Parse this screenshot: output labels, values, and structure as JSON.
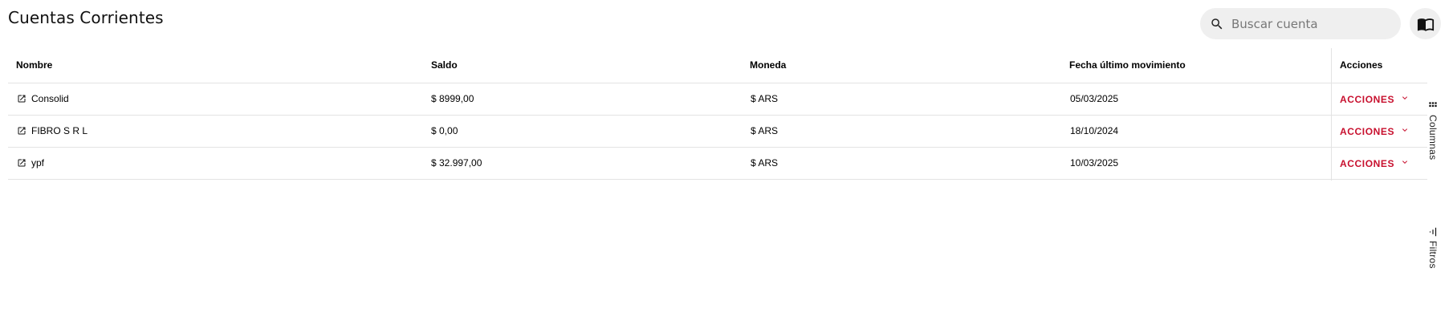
{
  "page": {
    "title": "Cuentas Corrientes"
  },
  "search": {
    "placeholder": "Buscar cuenta",
    "value": ""
  },
  "toolbar": {
    "doc_icon": "menu-book-icon"
  },
  "table": {
    "columns": [
      "Nombre",
      "Saldo",
      "Moneda",
      "Fecha último movimiento",
      "Acciones"
    ],
    "rows": [
      {
        "nombre": "Consolid",
        "saldo": "$ 8999,00",
        "moneda": "$ ARS",
        "fecha": "05/03/2025",
        "acciones": "ACCIONES"
      },
      {
        "nombre": "FIBRO S R L",
        "saldo": "$ 0,00",
        "moneda": "$ ARS",
        "fecha": "18/10/2024",
        "acciones": "ACCIONES"
      },
      {
        "nombre": "ypf",
        "saldo": "$ 32.997,00",
        "moneda": "$ ARS",
        "fecha": "10/03/2025",
        "acciones": "ACCIONES"
      }
    ]
  },
  "side_panel": {
    "columns_label": "Columnas",
    "filters_label": "Filtros"
  },
  "colors": {
    "accent": "#c8102e",
    "border": "#e3e3e3",
    "search_bg": "#efefef"
  }
}
